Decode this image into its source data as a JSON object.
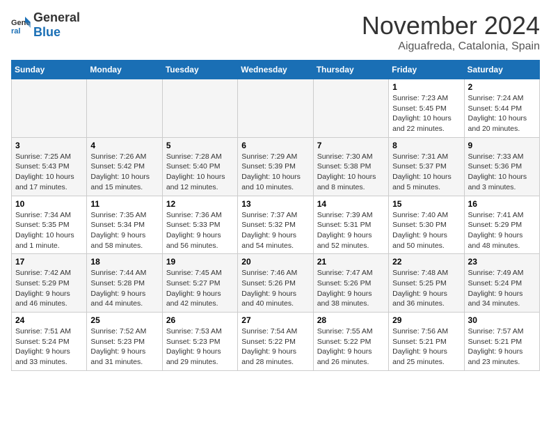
{
  "logo": {
    "general": "General",
    "blue": "Blue"
  },
  "title": "November 2024",
  "location": "Aiguafreda, Catalonia, Spain",
  "days_of_week": [
    "Sunday",
    "Monday",
    "Tuesday",
    "Wednesday",
    "Thursday",
    "Friday",
    "Saturday"
  ],
  "weeks": [
    [
      {
        "day": "",
        "empty": true
      },
      {
        "day": "",
        "empty": true
      },
      {
        "day": "",
        "empty": true
      },
      {
        "day": "",
        "empty": true
      },
      {
        "day": "",
        "empty": true
      },
      {
        "day": "1",
        "sunrise": "7:23 AM",
        "sunset": "5:45 PM",
        "daylight": "10 hours and 22 minutes."
      },
      {
        "day": "2",
        "sunrise": "7:24 AM",
        "sunset": "5:44 PM",
        "daylight": "10 hours and 20 minutes."
      }
    ],
    [
      {
        "day": "3",
        "sunrise": "7:25 AM",
        "sunset": "5:43 PM",
        "daylight": "10 hours and 17 minutes."
      },
      {
        "day": "4",
        "sunrise": "7:26 AM",
        "sunset": "5:42 PM",
        "daylight": "10 hours and 15 minutes."
      },
      {
        "day": "5",
        "sunrise": "7:28 AM",
        "sunset": "5:40 PM",
        "daylight": "10 hours and 12 minutes."
      },
      {
        "day": "6",
        "sunrise": "7:29 AM",
        "sunset": "5:39 PM",
        "daylight": "10 hours and 10 minutes."
      },
      {
        "day": "7",
        "sunrise": "7:30 AM",
        "sunset": "5:38 PM",
        "daylight": "10 hours and 8 minutes."
      },
      {
        "day": "8",
        "sunrise": "7:31 AM",
        "sunset": "5:37 PM",
        "daylight": "10 hours and 5 minutes."
      },
      {
        "day": "9",
        "sunrise": "7:33 AM",
        "sunset": "5:36 PM",
        "daylight": "10 hours and 3 minutes."
      }
    ],
    [
      {
        "day": "10",
        "sunrise": "7:34 AM",
        "sunset": "5:35 PM",
        "daylight": "10 hours and 1 minute."
      },
      {
        "day": "11",
        "sunrise": "7:35 AM",
        "sunset": "5:34 PM",
        "daylight": "9 hours and 58 minutes."
      },
      {
        "day": "12",
        "sunrise": "7:36 AM",
        "sunset": "5:33 PM",
        "daylight": "9 hours and 56 minutes."
      },
      {
        "day": "13",
        "sunrise": "7:37 AM",
        "sunset": "5:32 PM",
        "daylight": "9 hours and 54 minutes."
      },
      {
        "day": "14",
        "sunrise": "7:39 AM",
        "sunset": "5:31 PM",
        "daylight": "9 hours and 52 minutes."
      },
      {
        "day": "15",
        "sunrise": "7:40 AM",
        "sunset": "5:30 PM",
        "daylight": "9 hours and 50 minutes."
      },
      {
        "day": "16",
        "sunrise": "7:41 AM",
        "sunset": "5:29 PM",
        "daylight": "9 hours and 48 minutes."
      }
    ],
    [
      {
        "day": "17",
        "sunrise": "7:42 AM",
        "sunset": "5:29 PM",
        "daylight": "9 hours and 46 minutes."
      },
      {
        "day": "18",
        "sunrise": "7:44 AM",
        "sunset": "5:28 PM",
        "daylight": "9 hours and 44 minutes."
      },
      {
        "day": "19",
        "sunrise": "7:45 AM",
        "sunset": "5:27 PM",
        "daylight": "9 hours and 42 minutes."
      },
      {
        "day": "20",
        "sunrise": "7:46 AM",
        "sunset": "5:26 PM",
        "daylight": "9 hours and 40 minutes."
      },
      {
        "day": "21",
        "sunrise": "7:47 AM",
        "sunset": "5:26 PM",
        "daylight": "9 hours and 38 minutes."
      },
      {
        "day": "22",
        "sunrise": "7:48 AM",
        "sunset": "5:25 PM",
        "daylight": "9 hours and 36 minutes."
      },
      {
        "day": "23",
        "sunrise": "7:49 AM",
        "sunset": "5:24 PM",
        "daylight": "9 hours and 34 minutes."
      }
    ],
    [
      {
        "day": "24",
        "sunrise": "7:51 AM",
        "sunset": "5:24 PM",
        "daylight": "9 hours and 33 minutes."
      },
      {
        "day": "25",
        "sunrise": "7:52 AM",
        "sunset": "5:23 PM",
        "daylight": "9 hours and 31 minutes."
      },
      {
        "day": "26",
        "sunrise": "7:53 AM",
        "sunset": "5:23 PM",
        "daylight": "9 hours and 29 minutes."
      },
      {
        "day": "27",
        "sunrise": "7:54 AM",
        "sunset": "5:22 PM",
        "daylight": "9 hours and 28 minutes."
      },
      {
        "day": "28",
        "sunrise": "7:55 AM",
        "sunset": "5:22 PM",
        "daylight": "9 hours and 26 minutes."
      },
      {
        "day": "29",
        "sunrise": "7:56 AM",
        "sunset": "5:21 PM",
        "daylight": "9 hours and 25 minutes."
      },
      {
        "day": "30",
        "sunrise": "7:57 AM",
        "sunset": "5:21 PM",
        "daylight": "9 hours and 23 minutes."
      }
    ]
  ]
}
